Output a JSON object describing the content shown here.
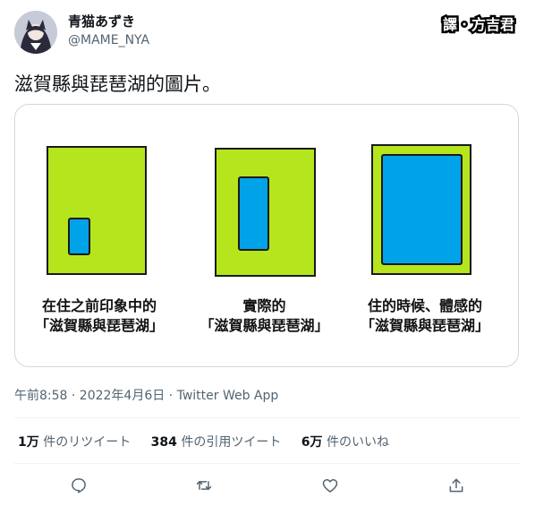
{
  "author": {
    "display_name": "青猫あずき",
    "handle": "@MAME_NYA"
  },
  "watermark": {
    "left": "譯",
    "right": "方吉君"
  },
  "tweet": {
    "text": "滋賀縣與琵琶湖的圖片。"
  },
  "media": {
    "panels": [
      {
        "caption_line1": "在住之前印象中的",
        "caption_line2": "「滋賀縣與琵琶湖」"
      },
      {
        "caption_line1": "實際的",
        "caption_line2": "「滋賀縣與琵琶湖」"
      },
      {
        "caption_line1": "住的時候、體感的",
        "caption_line2": "「滋賀縣與琵琶湖」"
      }
    ],
    "colors": {
      "land": "#b5e61d",
      "lake": "#00a2e8",
      "outline": "#1a1a1a"
    }
  },
  "meta": {
    "timestamp": "午前8:58 · 2022年4月6日 · Twitter Web App"
  },
  "stats": {
    "retweets_count": "1万",
    "retweets_label": "件のリツイート",
    "quotes_count": "384",
    "quotes_label": "件の引用ツイート",
    "likes_count": "6万",
    "likes_label": "件のいいね"
  },
  "actions": [
    "reply-icon",
    "retweet-icon",
    "like-icon",
    "share-icon"
  ]
}
